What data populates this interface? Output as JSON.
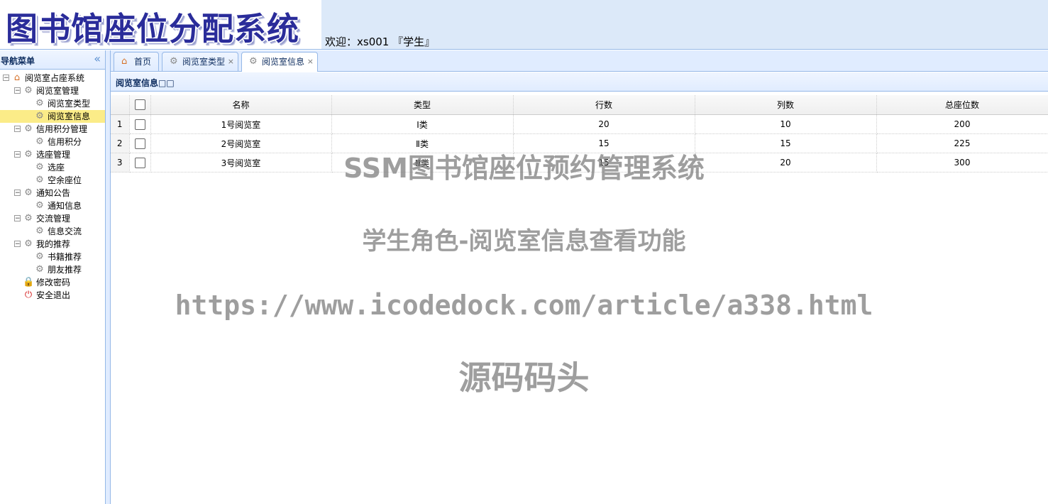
{
  "header": {
    "logo_text": "图书馆座位分配系统",
    "welcome": "欢迎：xs001 『学生』"
  },
  "nav": {
    "title": "导航菜单",
    "collapse_icon": "double-chevron-left-icon",
    "tree": [
      {
        "label": "阅览室占座系统",
        "icon": "home-icon",
        "level": 0,
        "toggle": "⊟"
      },
      {
        "label": "阅览室管理",
        "icon": "gear-icon",
        "level": 1,
        "toggle": "⊟"
      },
      {
        "label": "阅览室类型",
        "icon": "gear-icon",
        "level": 2
      },
      {
        "label": "阅览室信息",
        "icon": "gear-icon",
        "level": 2,
        "selected": true
      },
      {
        "label": "信用积分管理",
        "icon": "gear-icon",
        "level": 1,
        "toggle": "⊟"
      },
      {
        "label": "信用积分",
        "icon": "gear-icon",
        "level": 2
      },
      {
        "label": "选座管理",
        "icon": "gear-icon",
        "level": 1,
        "toggle": "⊟"
      },
      {
        "label": "选座",
        "icon": "gear-icon",
        "level": 2
      },
      {
        "label": "空余座位",
        "icon": "gear-icon",
        "level": 2
      },
      {
        "label": "通知公告",
        "icon": "gear-icon",
        "level": 1,
        "toggle": "⊟"
      },
      {
        "label": "通知信息",
        "icon": "gear-icon",
        "level": 2
      },
      {
        "label": "交流管理",
        "icon": "gear-icon",
        "level": 1,
        "toggle": "⊟"
      },
      {
        "label": "信息交流",
        "icon": "gear-icon",
        "level": 2
      },
      {
        "label": "我的推荐",
        "icon": "gear-icon",
        "level": 1,
        "toggle": "⊟"
      },
      {
        "label": "书籍推荐",
        "icon": "gear-icon",
        "level": 2
      },
      {
        "label": "朋友推荐",
        "icon": "gear-icon",
        "level": 2
      },
      {
        "label": "修改密码",
        "icon": "lock-icon",
        "level": 1
      },
      {
        "label": "安全退出",
        "icon": "exit-icon",
        "level": 1
      }
    ]
  },
  "tabs": [
    {
      "label": "首页",
      "icon": "home-icon",
      "closable": false,
      "active": false
    },
    {
      "label": "阅览室类型",
      "icon": "gear-icon",
      "closable": true,
      "active": false
    },
    {
      "label": "阅览室信息",
      "icon": "gear-icon",
      "closable": true,
      "active": true
    }
  ],
  "panel": {
    "title": "阅览室信息□□"
  },
  "grid": {
    "columns": [
      "名称",
      "类型",
      "行数",
      "列数",
      "总座位数"
    ],
    "rows": [
      [
        "1",
        "1号阅览室",
        "Ⅰ类",
        "20",
        "10",
        "200"
      ],
      [
        "2",
        "2号阅览室",
        "Ⅱ类",
        "15",
        "15",
        "225"
      ],
      [
        "3",
        "3号阅览室",
        "Ⅲ类",
        "15",
        "20",
        "300"
      ]
    ]
  },
  "watermark": {
    "line1": "SSM图书馆座位预约管理系统",
    "line2": "学生角色-阅览室信息查看功能",
    "line3": "https://www.icodedock.com/article/a338.html",
    "line4": "源码码头"
  }
}
